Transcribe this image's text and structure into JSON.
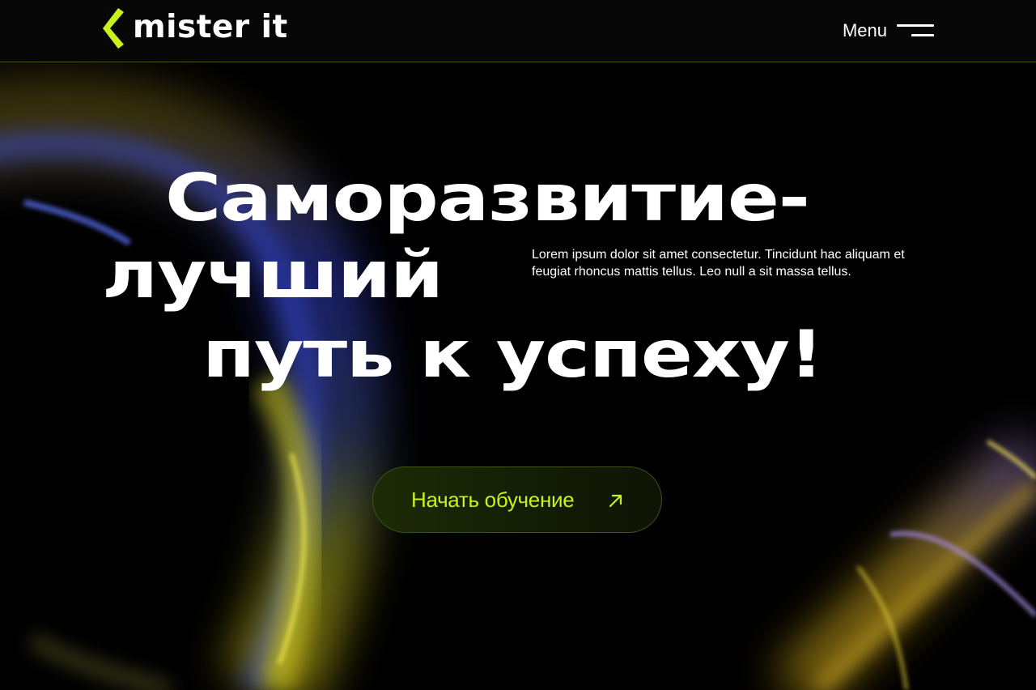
{
  "brand": {
    "name": "mister it",
    "accent": "#c8f21a"
  },
  "header": {
    "menu_label": "Menu",
    "menu_icon": "burger-icon"
  },
  "hero": {
    "headline_lines": [
      "Саморазвитие-",
      "лучший",
      "путь к успеху!"
    ],
    "lead": "Lorem ipsum dolor sit amet consectetur. Tincidunt hac aliquam et feugiat rhoncus mattis tellus. Leo null a sit massa tellus.",
    "cta_label": "Начать обучение",
    "cta_icon": "arrow-up-right-icon"
  },
  "colors": {
    "background": "#000000",
    "text": "#ffffff",
    "cta_text": "#c8f21a",
    "header_border": "#3f5a12"
  }
}
